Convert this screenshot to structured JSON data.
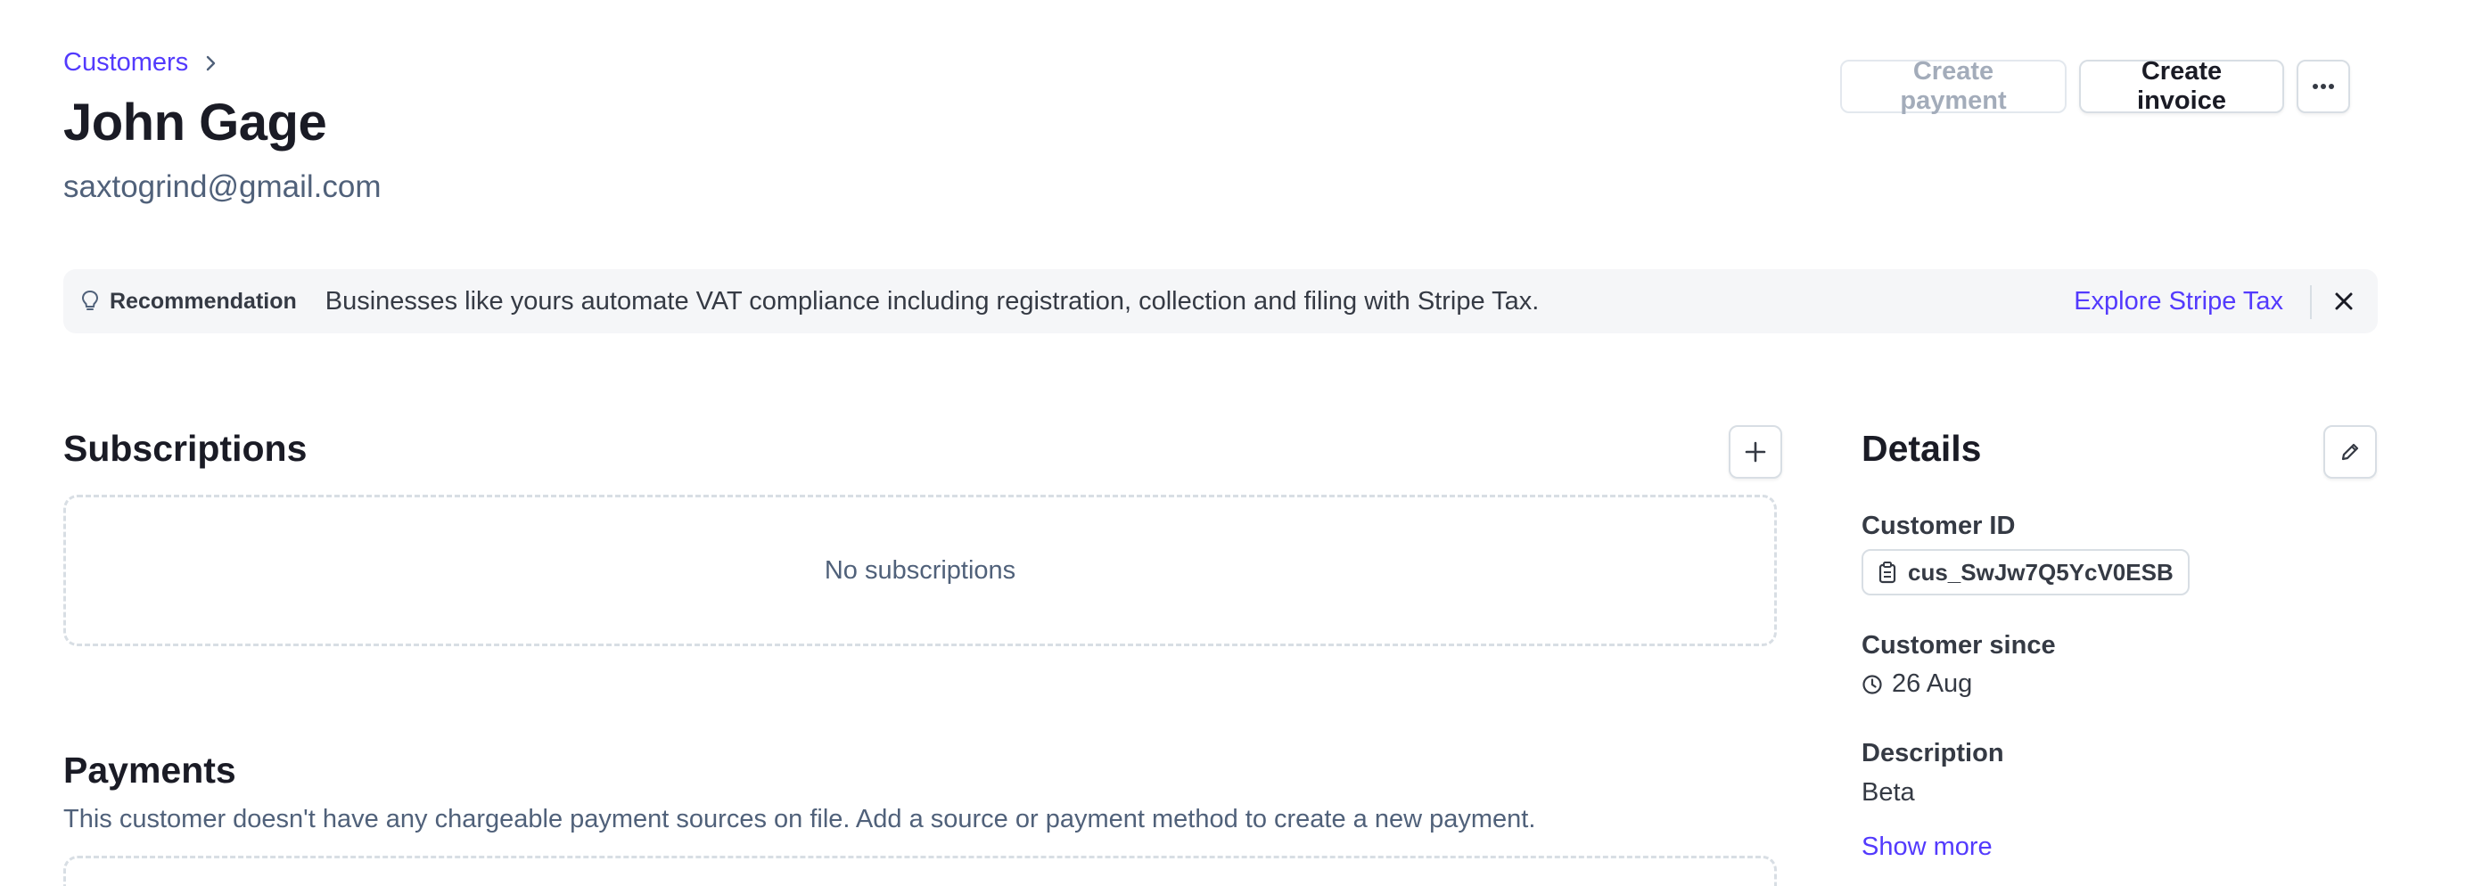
{
  "breadcrumb": {
    "label": "Customers"
  },
  "customer": {
    "name": "John Gage",
    "email": "saxtogrind@gmail.com"
  },
  "actions": {
    "create_payment": "Create payment",
    "create_invoice": "Create invoice",
    "more_icon": "ellipsis-icon"
  },
  "recommendation": {
    "label": "Recommendation",
    "text": "Businesses like yours automate VAT compliance including registration, collection and filing with Stripe Tax.",
    "link": "Explore Stripe Tax"
  },
  "subscriptions": {
    "title": "Subscriptions",
    "empty": "No subscriptions"
  },
  "payments": {
    "title": "Payments",
    "description": "This customer doesn't have any chargeable payment sources on file. Add a source or payment method to create a new payment."
  },
  "details": {
    "title": "Details",
    "customer_id_label": "Customer ID",
    "customer_id": "cus_SwJw7Q5YcV0ESB",
    "since_label": "Customer since",
    "since": "26 Aug",
    "description_label": "Description",
    "description": "Beta",
    "show_more": "Show more"
  },
  "colors": {
    "accent": "#533afd",
    "text": "#1a1b25",
    "muted": "#50617a",
    "border": "#d8dee4",
    "banner_bg": "#f5f6f8"
  }
}
